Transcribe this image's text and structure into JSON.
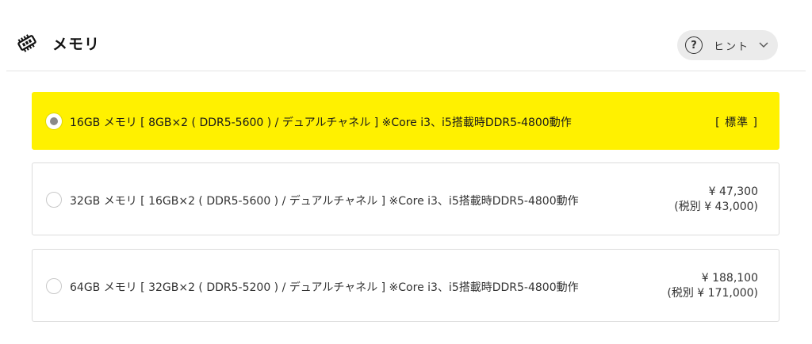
{
  "section": {
    "title": "メモリ",
    "icon": "memory-chip-icon",
    "hint_label": "ヒント",
    "hint_icon_glyph": "?"
  },
  "options": [
    {
      "label": "16GB メモリ [ 8GB×2 ( DDR5-5600 ) / デュアルチャネル ] ※Core i3、i5搭載時DDR5-4800動作",
      "standard": "[ 標準 ]",
      "selected": true
    },
    {
      "label": "32GB メモリ [ 16GB×2 ( DDR5-5600 ) / デュアルチャネル ] ※Core i3、i5搭載時DDR5-4800動作",
      "price": "¥ 47,300",
      "price_excl_tax": "(税別 ¥ 43,000)",
      "selected": false
    },
    {
      "label": "64GB メモリ [ 32GB×2 ( DDR5-5200 ) / デュアルチャネル ] ※Core i3、i5搭載時DDR5-4800動作",
      "price": "¥ 188,100",
      "price_excl_tax": "(税別 ¥ 171,000)",
      "selected": false
    }
  ],
  "colors": {
    "selected_bg": "#fff100",
    "hint_bg": "#ebebeb",
    "border": "#dcdcdc"
  }
}
